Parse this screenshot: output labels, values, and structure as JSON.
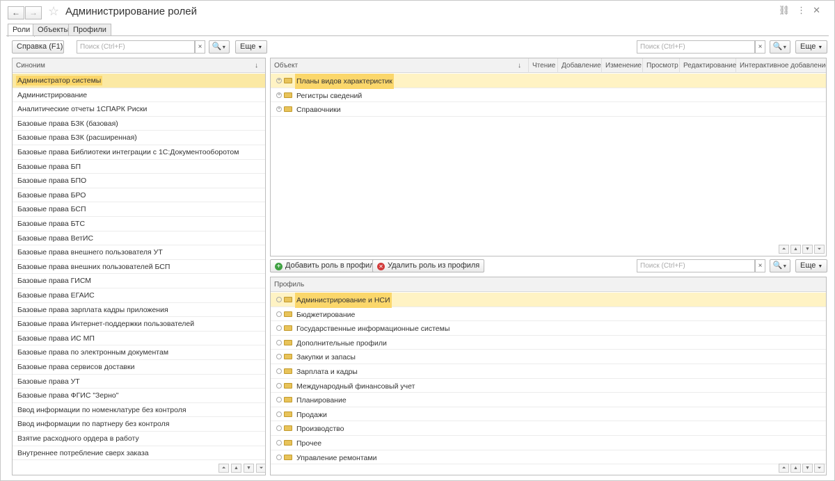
{
  "window": {
    "title": "Администрирование ролей"
  },
  "tabs": [
    {
      "label": "Роли"
    },
    {
      "label": "Объекты"
    },
    {
      "label": "Профили"
    }
  ],
  "left": {
    "help_button": "Справка (F1)",
    "search_placeholder": "Поиск (Ctrl+F)",
    "more_label": "Еще",
    "column": "Синоним",
    "sort_arrow": "↓",
    "items": [
      "Администратор системы",
      "Администрирование",
      "Аналитические отчеты 1СПАРК Риски",
      "Базовые права БЗК (базовая)",
      "Базовые права БЗК (расширенная)",
      "Базовые права Библиотеки интеграции с 1С:Документооборотом",
      "Базовые права БП",
      "Базовые права БПО",
      "Базовые права БРО",
      "Базовые права БСП",
      "Базовые права БТС",
      "Базовые права ВетИС",
      "Базовые права внешнего пользователя УТ",
      "Базовые права внешних пользователей БСП",
      "Базовые права ГИСМ",
      "Базовые права ЕГАИС",
      "Базовые права зарплата кадры приложения",
      "Базовые права Интернет-поддержки пользователей",
      "Базовые права ИС МП",
      "Базовые права по электронным документам",
      "Базовые права сервисов доставки",
      "Базовые права УТ",
      "Базовые права ФГИС \"Зерно\"",
      "Ввод информации по номенклатуре без контроля",
      "Ввод информации по партнеру без контроля",
      "Взятие расходного ордера в работу",
      "Внутреннее потребление сверх заказа"
    ]
  },
  "objects": {
    "search_placeholder": "Поиск (Ctrl+F)",
    "more_label": "Еще",
    "columns": [
      "Объект",
      "Чтение",
      "Добавление",
      "Изменение",
      "Просмотр",
      "Редактирование",
      "Интерактивное добавление"
    ],
    "sort_arrow": "↓",
    "rows": [
      "Планы видов характеристик",
      "Регистры сведений",
      "Справочники"
    ]
  },
  "profiles": {
    "add_button": "Добавить роль в профиль",
    "remove_button": "Удалить роль из профиля",
    "search_placeholder": "Поиск (Ctrl+F)",
    "more_label": "Еще",
    "column": "Профиль",
    "rows": [
      "Администрирование и НСИ",
      "Бюджетирование",
      "Государственные информационные системы",
      "Дополнительные профили",
      "Закупки и запасы",
      "Зарплата и кадры",
      "Международный финансовый учет",
      "Планирование",
      "Продажи",
      "Производство",
      "Прочее",
      "Управление ремонтами"
    ]
  }
}
